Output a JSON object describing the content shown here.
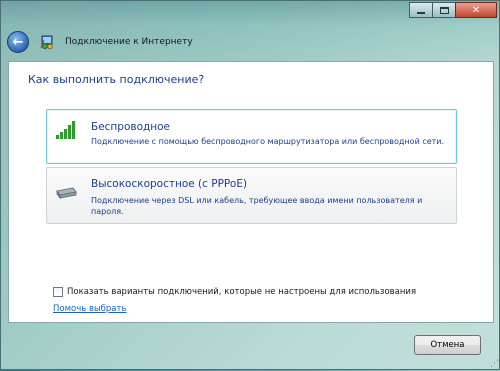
{
  "window": {
    "title": "Подключение к Интернету",
    "caption": {
      "minimize_icon": "minimize-icon",
      "maximize_icon": "maximize-icon",
      "close_icon": "close-icon",
      "close_glyph": "✕"
    }
  },
  "nav": {
    "back_icon": "back-arrow-icon",
    "back_glyph": "←",
    "app_icon": "globe-network-icon"
  },
  "main": {
    "heading": "Как выполнить подключение?",
    "options": [
      {
        "title": "Беспроводное",
        "description": "Подключение с помощью беспроводного маршрутизатора или беспроводной сети.",
        "icon": "wireless-signal-icon"
      },
      {
        "title": "Высокоскоростное (с PPPoE)",
        "description": "Подключение через DSL или кабель, требующее ввода имени пользователя и пароля.",
        "icon": "broadband-modem-icon"
      }
    ],
    "show_all_checkbox": {
      "label": "Показать варианты подключений, которые не настроены для использования",
      "checked": false
    },
    "help_link": "Помочь выбрать"
  },
  "footer": {
    "cancel_label": "Отмена"
  },
  "colors": {
    "link_blue": "#1b3f8b",
    "hover_border": "#6ec9e4",
    "signal_green": "#2f9a2f"
  }
}
